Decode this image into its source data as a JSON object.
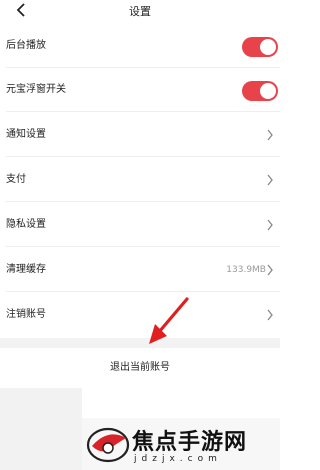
{
  "header": {
    "title": "设置"
  },
  "rows": [
    {
      "label": "后台播放",
      "type": "toggle",
      "on": true
    },
    {
      "label": "元宝浮窗开关",
      "type": "toggle",
      "on": true
    },
    {
      "label": "通知设置",
      "type": "link"
    },
    {
      "label": "支付",
      "type": "link"
    },
    {
      "label": "隐私设置",
      "type": "link"
    },
    {
      "label": "清理缓存",
      "type": "value",
      "value": "133.9MB"
    },
    {
      "label": "注销账号",
      "type": "link"
    }
  ],
  "logout_label": "退出当前账号",
  "watermark": {
    "brand": "焦点手游网",
    "domain": "jdzjx.com"
  },
  "colors": {
    "accent": "#e8424b",
    "arrow": "#e02020"
  },
  "icons": {
    "back": "chevron-left-icon",
    "row_link": "chevron-right-icon"
  }
}
